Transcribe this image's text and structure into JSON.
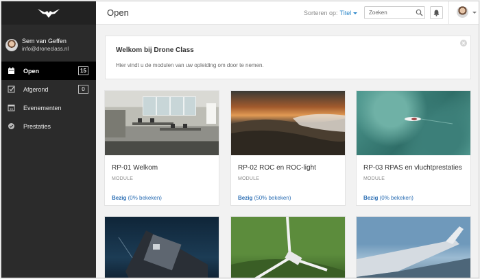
{
  "sidebar": {
    "user": {
      "name": "Sem van Geffen",
      "email": "info@droneclass.nl"
    },
    "items": [
      {
        "label": "Open",
        "count": "15",
        "icon": "calendar-icon",
        "active": true
      },
      {
        "label": "Afgerond",
        "count": "0",
        "icon": "checkbox-icon",
        "active": false
      },
      {
        "label": "Evenementen",
        "count": "",
        "icon": "calendar-15-icon",
        "active": false
      },
      {
        "label": "Prestaties",
        "count": "",
        "icon": "badge-check-icon",
        "active": false
      }
    ],
    "calendar_icon_number": "15"
  },
  "header": {
    "title": "Open",
    "sort_label": "Sorteren op:",
    "sort_value": "Titel",
    "search_placeholder": "Zoeken"
  },
  "welcome": {
    "title": "Welkom bij Drone Class",
    "text": "Hier vindt u de modulen van uw opleiding om door te nemen."
  },
  "cards": [
    {
      "title": "RP-01 Welkom",
      "type": "MODULE",
      "status": "Bezig",
      "progress_text": "(0% bekeken)",
      "progress": 0
    },
    {
      "title": "RP-02 ROC en ROC-light",
      "type": "MODULE",
      "status": "Bezig",
      "progress_text": "(50% bekeken)",
      "progress": 50
    },
    {
      "title": "RP-03 RPAS en vluchtprestaties",
      "type": "MODULE",
      "status": "Bezig",
      "progress_text": "(0% bekeken)",
      "progress": 0
    }
  ],
  "colors": {
    "accent": "#2a86c9",
    "sidebar_bg": "#2b2b2b",
    "active_bg": "#000000",
    "status": "#2a6db3"
  }
}
